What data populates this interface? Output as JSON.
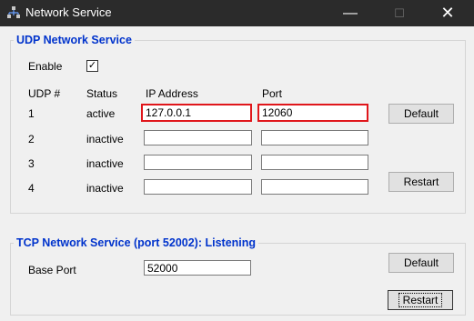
{
  "window": {
    "title": "Network Service",
    "min_symbol": "—",
    "max_symbol": "☐",
    "close_symbol": "✕"
  },
  "udp": {
    "legend": "UDP Network Service",
    "enable_label": "Enable",
    "enable_checked": true,
    "enable_mark": "✓",
    "headers": {
      "udp": "UDP #",
      "status": "Status",
      "ip": "IP Address",
      "port": "Port"
    },
    "rows": [
      {
        "num": "1",
        "status": "active",
        "ip": "127.0.0.1",
        "port": "12060"
      },
      {
        "num": "2",
        "status": "inactive",
        "ip": "",
        "port": ""
      },
      {
        "num": "3",
        "status": "inactive",
        "ip": "",
        "port": ""
      },
      {
        "num": "4",
        "status": "inactive",
        "ip": "",
        "port": ""
      }
    ],
    "default_button": "Default",
    "restart_button": "Restart"
  },
  "tcp": {
    "legend": "TCP Network Service (port 52002): Listening",
    "base_port_label": "Base Port",
    "base_port_value": "52000",
    "default_button": "Default",
    "restart_button": "Restart"
  },
  "colors": {
    "legend": "#0033cc",
    "highlight": "#e0161b",
    "titlebar": "#2b2b2b"
  }
}
